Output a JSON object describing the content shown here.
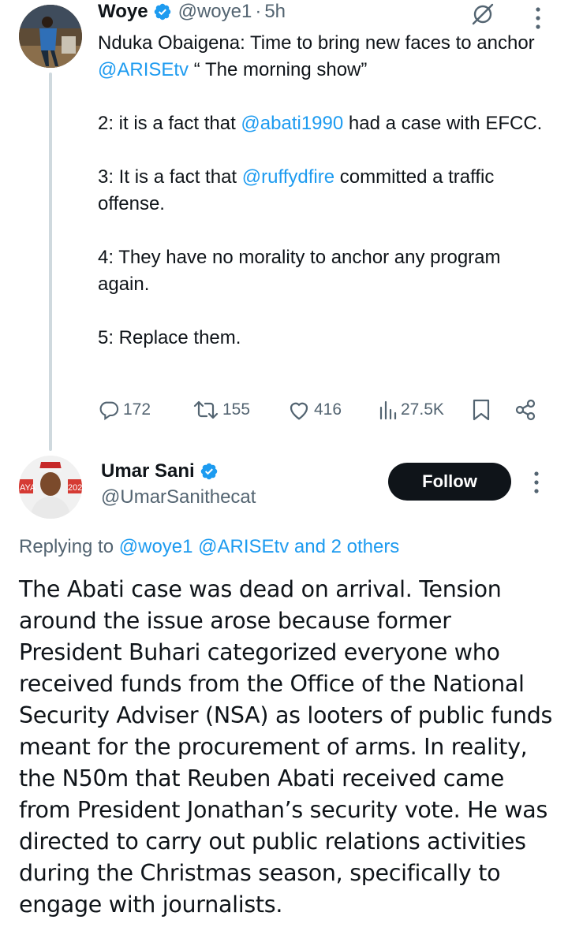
{
  "parent_tweet": {
    "name": "Woye",
    "handle": "@woye1",
    "separator": "·",
    "time": "5h",
    "paragraphs": [
      [
        {
          "text": "Nduka Obaigena: Time to bring new faces to anchor ",
          "mention": false
        },
        {
          "text": "@ARISEtv",
          "mention": true
        },
        {
          "text": " “ The morning show”",
          "mention": false
        }
      ],
      [
        {
          "text": "2: it is a fact that ",
          "mention": false
        },
        {
          "text": "@abati1990",
          "mention": true
        },
        {
          "text": " had a case with EFCC.",
          "mention": false
        }
      ],
      [
        {
          "text": "3: It is a fact that ",
          "mention": false
        },
        {
          "text": "@ruffydfire",
          "mention": true
        },
        {
          "text": " committed a traffic offense.",
          "mention": false
        }
      ],
      [
        {
          "text": "4: They have no morality to anchor any program again.",
          "mention": false
        }
      ],
      [
        {
          "text": "5: Replace them.",
          "mention": false
        }
      ]
    ],
    "stats": {
      "replies": "172",
      "reposts": "155",
      "likes": "416",
      "views": "27.5K"
    }
  },
  "reply_tweet": {
    "name": "Umar Sani",
    "handle": "@UmarSanithecat",
    "follow_label": "Follow",
    "replying_prefix": "Replying to ",
    "replying_targets": "@woye1 @ARISEtv and 2 others",
    "body": "The Abati case was dead on arrival. Tension around the issue arose because former President Buhari categorized everyone who received funds from the Office of the National Security Adviser (NSA) as looters of public funds meant for the procurement of arms. In reality, the N50m that Reuben Abati received came from President Jonathan’s security vote. He was directed to carry out public relations activities during the Christmas season, specifically to engage with journalists.",
    "avatar_backdrop_text_left": "AYA",
    "avatar_backdrop_text_right": "202"
  },
  "colors": {
    "accent": "#1d9bf0",
    "text": "#0f1419",
    "muted": "#536471",
    "thread_line": "#cfd9de",
    "follow_bg": "#0f1419"
  },
  "icons": [
    "verified-badge-icon",
    "grok-icon",
    "more-icon",
    "reply-icon",
    "repost-icon",
    "like-icon",
    "views-icon",
    "bookmark-icon",
    "share-icon"
  ]
}
